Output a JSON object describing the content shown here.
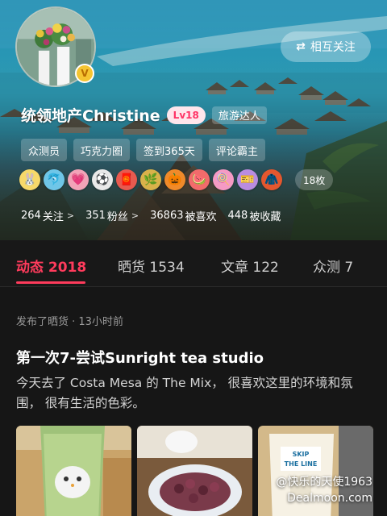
{
  "header": {
    "mutual_follow_label": "相互关注",
    "mutual_follow_icon": "swap-arrows-icon"
  },
  "profile": {
    "username": "统领地产Christine",
    "level": "Lv18",
    "title_badge": "旅游达人",
    "verified_icon": "v-badge-icon",
    "tags": [
      "众测员",
      "巧克力圈",
      "签到365天",
      "评论霸主"
    ],
    "medals": [
      {
        "icon": "rabbit-medal-icon",
        "glyph": "🐰",
        "color": "#f6d86a"
      },
      {
        "icon": "dolphin-medal-icon",
        "glyph": "🐬",
        "color": "#6fc6e8"
      },
      {
        "icon": "angel-heart-medal-icon",
        "glyph": "💗",
        "color": "#f2a3b8"
      },
      {
        "icon": "ball-medal-icon",
        "glyph": "⚽",
        "color": "#e9e9e9"
      },
      {
        "icon": "redpacket-medal-icon",
        "glyph": "🧧",
        "color": "#e85a4f"
      },
      {
        "icon": "wreath-medal-icon",
        "glyph": "🌿",
        "color": "#d9b24a"
      },
      {
        "icon": "pumpkin-medal-icon",
        "glyph": "🎃",
        "color": "#f08a2a"
      },
      {
        "icon": "watermelon-medal-icon",
        "glyph": "🍉",
        "color": "#f26b6b"
      },
      {
        "icon": "popsicle-medal-icon",
        "glyph": "🍭",
        "color": "#f59ac4"
      },
      {
        "icon": "ticket-medal-icon",
        "glyph": "🎫",
        "color": "#b98ce0"
      },
      {
        "icon": "sweater-medal-icon",
        "glyph": "🧥",
        "color": "#e4572e"
      }
    ],
    "medal_count": "18枚",
    "stats": [
      {
        "value": "264",
        "label": "关注",
        "chevron": true
      },
      {
        "value": "351",
        "label": "粉丝",
        "chevron": true
      },
      {
        "value": "36863",
        "label": "被喜欢",
        "chevron": false
      },
      {
        "value": "448",
        "label": "被收藏",
        "chevron": false
      }
    ]
  },
  "tabs": [
    {
      "label": "动态 2018",
      "active": true
    },
    {
      "label": "晒货 1534",
      "active": false
    },
    {
      "label": "文章 122",
      "active": false
    },
    {
      "label": "众测 7",
      "active": false
    }
  ],
  "post": {
    "meta": "发布了晒货 · 13小时前",
    "title": "第一次7-尝试Sunright tea studio",
    "body": "今天去了 Costa Mesa 的 The Mix，  很喜欢这里的环境和氛围，  很有生活的色彩。",
    "cup_label": "SKIP THE LINE"
  },
  "watermark": {
    "line1": "@快乐的天使1963",
    "line2": "Dealmoon.com"
  },
  "colors": {
    "accent": "#ff3b5c",
    "background": "#161616"
  }
}
